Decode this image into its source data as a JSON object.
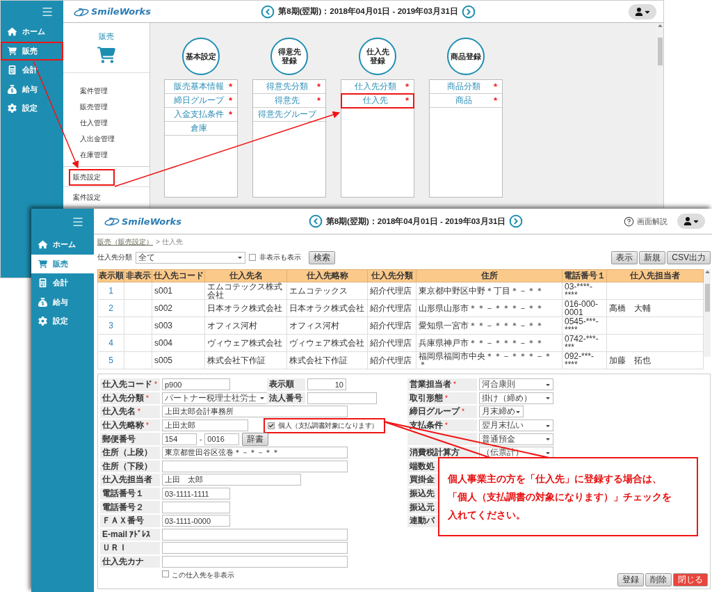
{
  "back_window": {
    "logo": "SmileWorks",
    "period": "第8期(翌期)：2018年04月01日 - 2019年03月31日",
    "nav": [
      {
        "label": "ホーム",
        "kind": "home",
        "annotated": false
      },
      {
        "label": "販売",
        "kind": "cart",
        "annotated": true
      },
      {
        "label": "会計",
        "kind": "calculator",
        "annotated": false
      },
      {
        "label": "給与",
        "kind": "money-bag",
        "annotated": false
      },
      {
        "label": "設定",
        "kind": "gear",
        "annotated": false
      }
    ],
    "submenu": {
      "title": "販売",
      "items": [
        "案件管理",
        "販売管理",
        "仕入管理",
        "入出金管理",
        "在庫管理"
      ],
      "settings": [
        {
          "label": "販売設定",
          "annotated": true
        },
        {
          "label": "案件設定",
          "annotated": false
        }
      ]
    },
    "groups": [
      {
        "title": [
          "基本設定"
        ],
        "items": [
          {
            "label": "販売基本情報",
            "mark": "*",
            "annotated": false
          },
          {
            "label": "締日グループ",
            "mark": "*",
            "annotated": false
          },
          {
            "label": "入金支払条件",
            "mark": "*",
            "annotated": false
          },
          {
            "label": "倉庫",
            "annotated": false
          }
        ]
      },
      {
        "title": [
          "得意先",
          "登録"
        ],
        "items": [
          {
            "label": "得意先分類",
            "mark": "*",
            "annotated": false
          },
          {
            "label": "得意先",
            "mark": "*",
            "annotated": false
          },
          {
            "label": "得意先グループ",
            "annotated": false
          }
        ]
      },
      {
        "title": [
          "仕入先",
          "登録"
        ],
        "items": [
          {
            "label": "仕入先分類",
            "mark": "*",
            "annotated": false
          },
          {
            "label": "仕入先",
            "mark": "*",
            "annotated": true
          }
        ]
      },
      {
        "title": [
          "商品登録"
        ],
        "items": [
          {
            "label": "商品分類",
            "mark": "*",
            "annotated": false
          },
          {
            "label": "商品",
            "mark": "*",
            "annotated": false
          }
        ]
      }
    ]
  },
  "front_window": {
    "logo": "SmileWorks",
    "period": "第8期(翌期)：2018年04月01日 - 2019年03月31日",
    "help": "画面解説",
    "nav": [
      {
        "label": "ホーム",
        "kind": "home",
        "selected": false
      },
      {
        "label": "販売",
        "kind": "cart",
        "selected": true
      },
      {
        "label": "会計",
        "kind": "calculator",
        "selected": false
      },
      {
        "label": "給与",
        "kind": "money-bag",
        "selected": false
      },
      {
        "label": "設定",
        "kind": "gear",
        "selected": false
      }
    ],
    "breadcrumb": {
      "link": "販売（販売設定）",
      "current": "> 仕入先"
    },
    "filter": {
      "label": "仕入先分類",
      "value": "全て",
      "checkbox": {
        "label": "非表示も表示",
        "checked": false
      },
      "button": "検索"
    },
    "actions": [
      "表示",
      "新規",
      "CSV出力"
    ],
    "table": {
      "columns": [
        "表示順",
        "非表示",
        "仕入先コード",
        "仕入先名",
        "仕入先略称",
        "仕入先分類",
        "住所",
        "電話番号１",
        "仕入先担当者"
      ],
      "rows": [
        {
          "order": "1",
          "code": "s001",
          "name": "エムコテックス株式会社",
          "short": "エムコテックス",
          "category": "紹介代理店",
          "address": "東京都中野区中野＊丁目＊－＊＊",
          "phone": "03-****-****"
        },
        {
          "order": "2",
          "code": "s002",
          "name": "日本オラク株式会社",
          "short": "日本オラク株式会社",
          "category": "紹介代理店",
          "address": "山形県山形市＊＊－＊＊＊－＊＊",
          "phone": "016-000-0001",
          "contact": "高橋　大輔"
        },
        {
          "order": "3",
          "code": "s003",
          "name": "オフィス河村",
          "short": "オフィス河村",
          "category": "紹介代理店",
          "address": "愛知県一宮市＊＊－＊＊＊－＊＊",
          "phone": "0545-***-****"
        },
        {
          "order": "4",
          "code": "s004",
          "name": "ヴィウェア株式会社",
          "short": "ヴィウェア株式会社",
          "category": "紹介代理店",
          "address": "兵庫県神戸市＊＊－＊＊＊－＊＊",
          "phone": "0742-***-***"
        },
        {
          "order": "5",
          "code": "s005",
          "name": "株式会社下作証",
          "short": "株式会社下作証",
          "category": "紹介代理店",
          "address": "福岡県福岡市中央＊＊－＊＊＊－＊＊",
          "phone": "092-***-****",
          "contact": "加藤　拓也"
        }
      ]
    },
    "form": {
      "left": [
        {
          "label": "仕入先コード",
          "mark": "*",
          "kind": "text",
          "value": "p900",
          "side": {
            "kind": "number",
            "label": "表示順",
            "value": "10"
          }
        },
        {
          "label": "仕入先分類",
          "mark": "*",
          "kind": "select",
          "value": "パートナー税理士社労士",
          "side": {
            "kind": "text",
            "label": "法人番号"
          }
        },
        {
          "label": "仕入先名",
          "mark": "*",
          "kind": "text",
          "value": "上田太郎会計事務所"
        },
        {
          "label": "仕入先略称",
          "mark": "*",
          "kind": "text",
          "value": "上田太郎",
          "side": {
            "kind": "checkbox",
            "label": "個人（支払調書対象になります）",
            "checked": true,
            "annotated": true
          }
        },
        {
          "label": "郵便番号",
          "kind": "postal",
          "values": [
            "154",
            "0016"
          ],
          "separator": "-",
          "button": "辞書"
        },
        {
          "label": "住所（上段）",
          "kind": "text",
          "value": "東京都世田谷区弦巻＊－＊－＊＊"
        },
        {
          "label": "住所（下段）",
          "kind": "text"
        },
        {
          "label": "仕入先担当者",
          "kind": "text",
          "value": "上田　太郎"
        },
        {
          "label": "電話番号１",
          "kind": "text",
          "value": "03-1111-1111"
        },
        {
          "label": "電話番号２",
          "kind": "text"
        },
        {
          "label": "ＦＡＸ番号",
          "kind": "text",
          "value": "03-1111-0000"
        },
        {
          "label": "E-mail ｱﾄﾞﾚｽ",
          "kind": "text"
        },
        {
          "label": "ＵＲＩ",
          "kind": "text"
        },
        {
          "label": "仕入先カナ",
          "kind": "text"
        }
      ],
      "right": [
        {
          "label": "営業担当者",
          "mark": "*",
          "value": "河合康則"
        },
        {
          "label": "取引形態",
          "mark": "*",
          "value": "掛け（締め）"
        },
        {
          "label": "締日グループ",
          "mark": "*",
          "value": "月末締め"
        },
        {
          "label": "支払条件",
          "mark": "*",
          "value": "翌月末払い"
        },
        {
          "value": "普通預金"
        },
        {
          "label": "消費税計算方",
          "value": "（伝票計）"
        },
        {
          "label": "端数処"
        },
        {
          "label": "買掛金"
        },
        {
          "label": "振込先"
        },
        {
          "label": "振込元"
        },
        {
          "label": "連動パ"
        }
      ],
      "hide_checkbox": {
        "label": "この仕入先を非表示",
        "checked": false
      },
      "buttons": [
        {
          "label": "登録",
          "kind": "normal"
        },
        {
          "label": "削除",
          "kind": "normal"
        },
        {
          "label": "閉じる",
          "kind": "danger"
        }
      ]
    }
  },
  "callout": {
    "lines": [
      "個人事業主の方を「仕入先」に登録する場合は、",
      "「個人（支払調書の対象になります）」チェックを",
      "入れてください。"
    ]
  }
}
